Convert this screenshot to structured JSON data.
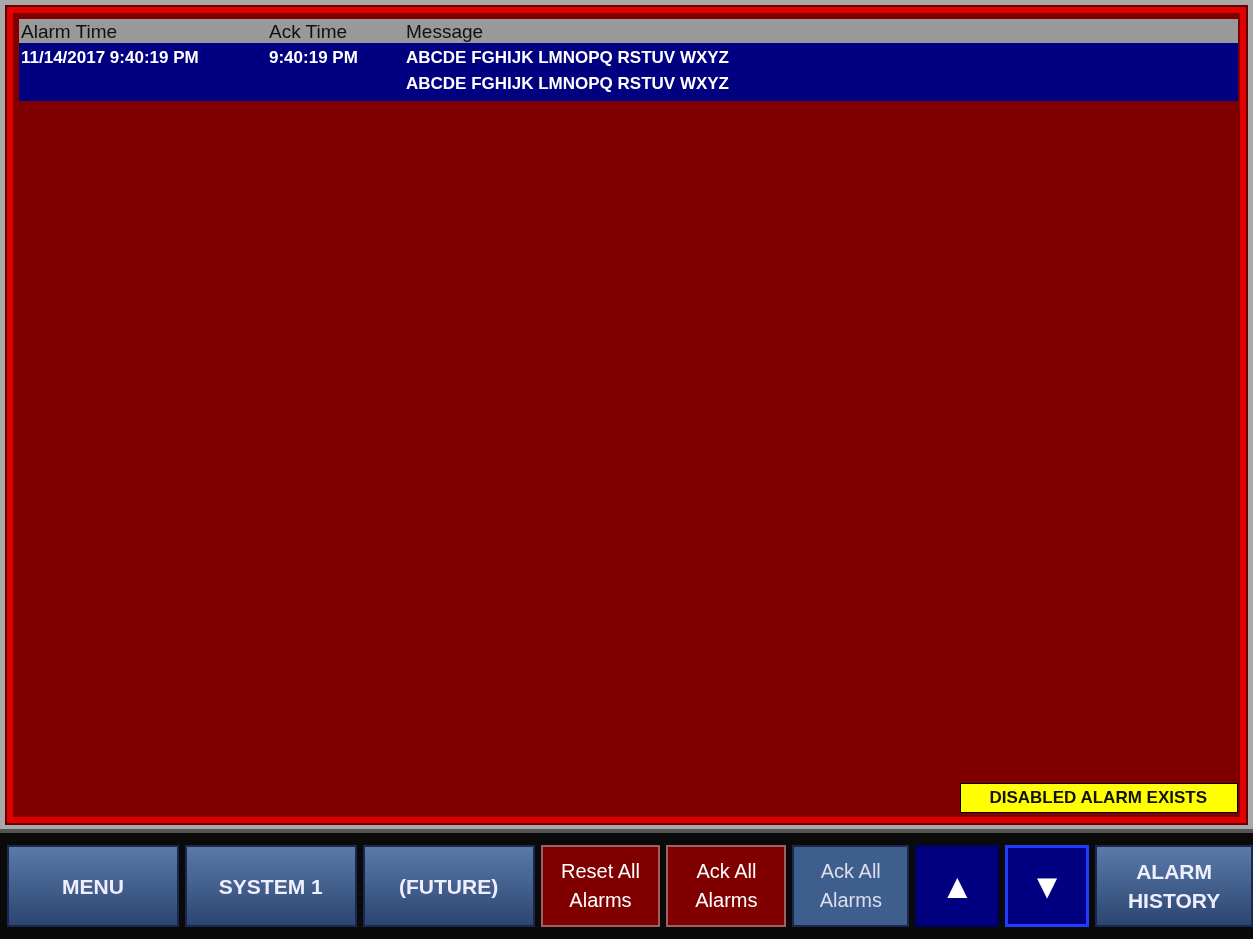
{
  "alarm_table": {
    "columns": [
      "Alarm Time",
      "Ack Time",
      "Message"
    ],
    "rows": [
      {
        "alarm_time": "11/14/2017 9:40:19 PM",
        "ack_time": "9:40:19 PM",
        "message_lines": [
          "ABCDE FGHIJK LMNOPQ RSTUV WXYZ",
          "ABCDE FGHIJK LMNOPQ RSTUV WXYZ"
        ],
        "selected": true
      }
    ]
  },
  "status_badge": "DISABLED ALARM EXISTS",
  "buttons": [
    {
      "label": "MENU",
      "kind": "nav",
      "selected": false
    },
    {
      "label": "SYSTEM 1",
      "kind": "nav",
      "selected": false
    },
    {
      "label": "(FUTURE)",
      "kind": "nav",
      "selected": false
    },
    {
      "label": "Reset All Alarms",
      "kind": "alarm",
      "selected": false
    },
    {
      "label": "Ack All Alarms",
      "kind": "alarm",
      "selected": false
    },
    {
      "label": "Ack All Alarms",
      "kind": "plain",
      "selected": false
    },
    {
      "label": "▲",
      "kind": "arrow",
      "selected": false
    },
    {
      "label": "▼",
      "kind": "arrow",
      "selected": true
    },
    {
      "label": "ALARM HISTORY",
      "kind": "nav",
      "selected": false
    }
  ]
}
